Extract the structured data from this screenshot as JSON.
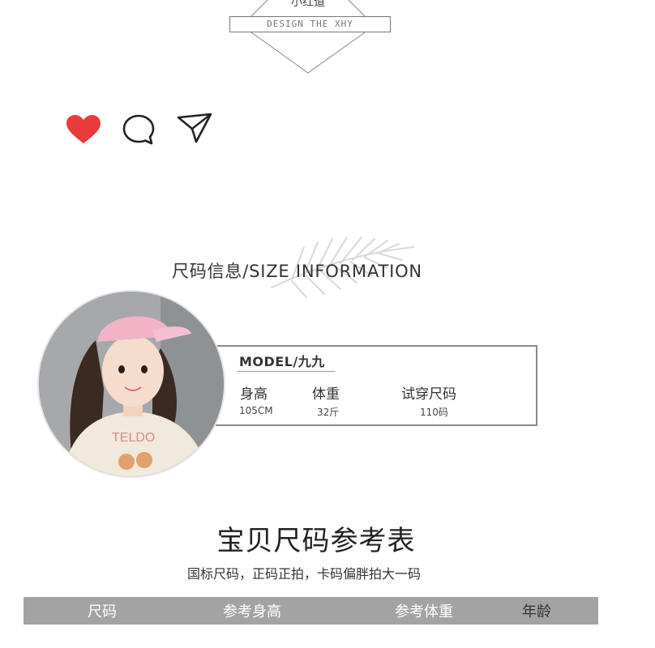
{
  "brand": {
    "name": "小红道",
    "tagline": "DESIGN THE XHY"
  },
  "actions": {
    "like_icon": "heart-icon",
    "comment_icon": "comment-icon",
    "share_icon": "send-icon",
    "like_color": "#e8393b"
  },
  "size_info": {
    "title": "尺码信息/SIZE INFORMATION"
  },
  "model": {
    "label": "MODEL/九九",
    "headers": [
      "身高",
      "体重",
      "试穿尺码"
    ],
    "values": [
      "105CM",
      "32斤",
      "110码"
    ]
  },
  "size_chart": {
    "title": "宝贝尺码参考表",
    "note": "国标尺码，正码正拍，卡码偏胖拍大一码",
    "columns": [
      "尺码",
      "参考身高",
      "参考体重",
      "年龄"
    ]
  },
  "colors": {
    "table_header_bg": "#a3a3a3",
    "hat_pink": "#f2b3c6"
  }
}
